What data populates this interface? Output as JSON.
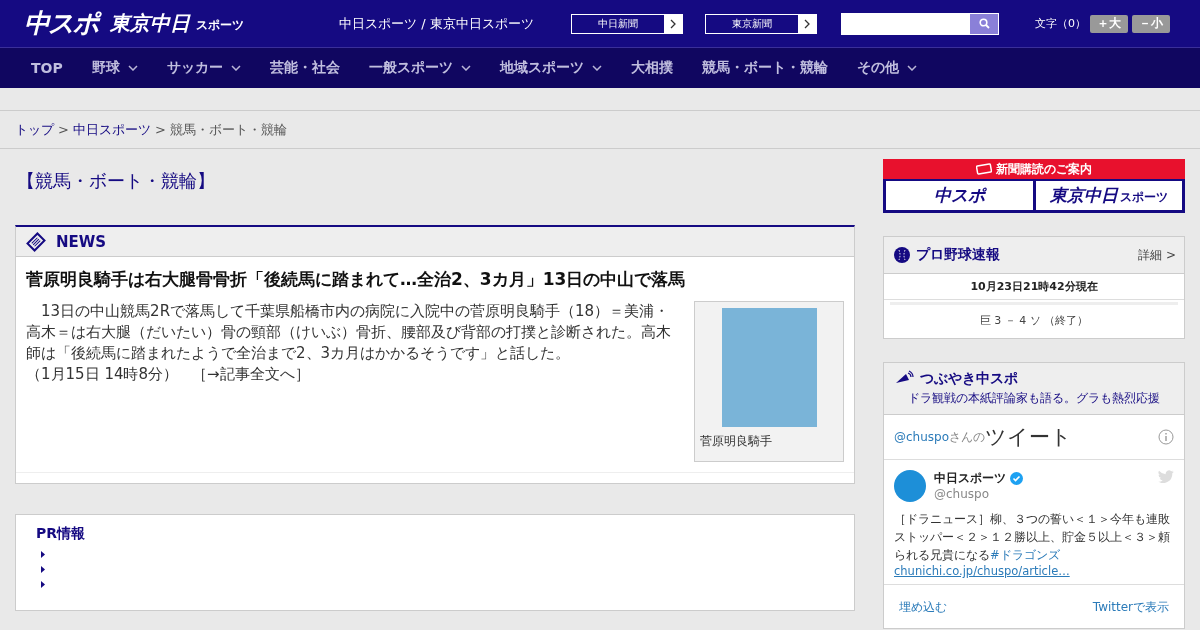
{
  "header": {
    "logo_main": "中スポ",
    "logo_tokyo": "東京中日",
    "logo_tokyo_sub": "スポーツ",
    "site_names": "中日スポーツ / 東京中日スポーツ",
    "links": [
      {
        "label": "中日新聞"
      },
      {
        "label": "東京新聞"
      }
    ],
    "font_size": {
      "label": "文字（0）",
      "buttons": [
        "＋大",
        "－小"
      ]
    }
  },
  "nav": [
    {
      "label": "TOP",
      "has_menu": false
    },
    {
      "label": "野球",
      "has_menu": true
    },
    {
      "label": "サッカー",
      "has_menu": true
    },
    {
      "label": "芸能・社会",
      "has_menu": false
    },
    {
      "label": "一般スポーツ",
      "has_menu": true
    },
    {
      "label": "地域スポーツ",
      "has_menu": true
    },
    {
      "label": "大相撲",
      "has_menu": false
    },
    {
      "label": "競馬・ボート・競輪",
      "has_menu": false
    },
    {
      "label": "その他",
      "has_menu": true
    }
  ],
  "breadcrumb": [
    {
      "kind": "link",
      "label": "トップ"
    },
    {
      "kind": "separator",
      "label": ">"
    },
    {
      "kind": "link",
      "label": "中日スポーツ"
    },
    {
      "kind": "separator",
      "label": ">"
    },
    {
      "kind": "current",
      "label": "競馬・ボート・競輪"
    }
  ],
  "page_title": "【競馬・ボート・競輪】",
  "news": {
    "heading": "NEWS",
    "headline": "菅原明良騎手は右大腿骨骨折「後続馬に踏まれて…全治2、3カ月」13日の中山で落馬",
    "body": "　13日の中山競馬2Rで落馬して千葉県船橋市内の病院に入院中の菅原明良騎手（18）＝美浦・高木＝は右大腿（だいたい）骨の頸部（けいぶ）骨折、腰部及び背部の打撲と診断された。高木師は「後続馬に踏まれたようで全治まで2、3カ月はかかるそうです」と話した。",
    "date": "（1月15日 14時8分）",
    "more_link": "［→記事全文へ］",
    "photo_caption": "菅原明良騎手"
  },
  "pr": {
    "title": "PR情報"
  },
  "sidebar": {
    "subscription": {
      "title": "新聞購読のご案内",
      "buttons": [
        "中スポ",
        "東京中日"
      ],
      "button_sub": "スポーツ"
    },
    "baseball": {
      "title": "プロ野球速報",
      "detail_link": "詳細 >",
      "timestamp": "10月23日21時42分現在",
      "score": "巨 3 － 4 ソ （終了）"
    },
    "tweets": {
      "title": "つぶやき中スポ",
      "subtitle": "ドラ観戦の本紙評論家も語る。グラも熱烈応援",
      "handle_link": "@chuspo",
      "handle_suffix": "さんの",
      "timeline_title": "ツイート",
      "author_name": "中日スポーツ",
      "author_handle": "@chuspo",
      "verified": true,
      "text": "［ドラニュース］柳、３つの誓い＜１＞今年も連敗ストッパー＜２＞１２勝以上、貯金５以上＜３＞頼られる兄貴になる",
      "hashtag": "#ドラゴンズ",
      "url": "chunichi.co.jp/chuspo/article…",
      "embed_link": "埋め込む",
      "view_link": "Twitterで表示"
    }
  }
}
